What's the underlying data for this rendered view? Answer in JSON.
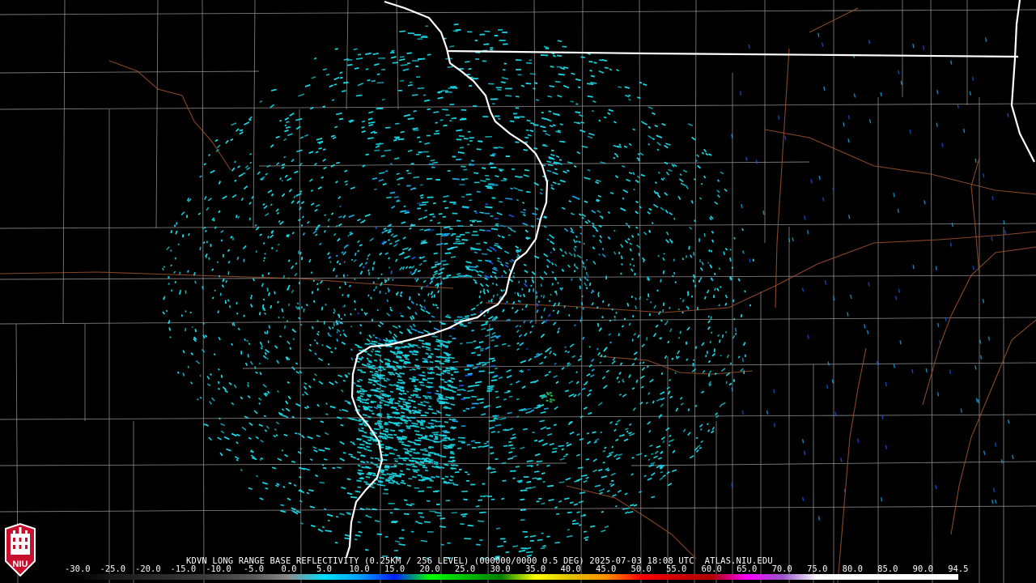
{
  "product": {
    "title": "KDVN LONG RANGE BASE REFLECTIVITY (0.25KM / 256 LEVEL) (000000/0000 0.5 DEG) 2025-07-03 18:08 UTC  ATLAS.NIU.EDU"
  },
  "legend": {
    "labels": [
      "-30.0",
      "-25.0",
      "-20.0",
      "-15.0",
      "-10.0",
      "-5.0",
      "0.0",
      "5.0",
      "10.0",
      "15.0",
      "20.0",
      "25.0",
      "30.0",
      "35.0",
      "40.0",
      "45.0",
      "50.0",
      "55.0",
      "60.0",
      "65.0",
      "70.0",
      "75.0",
      "80.0",
      "85.0",
      "90.0",
      "94.5"
    ],
    "stops": [
      "#000000",
      "#1a1a1a",
      "#262626",
      "#333333",
      "#404040",
      "#595959",
      "#8c8c8c",
      "#00e0ff",
      "#00a0ff",
      "#0020ff",
      "#00ff00",
      "#00c000",
      "#008000",
      "#ffff00",
      "#e0c000",
      "#ff9000",
      "#ff0000",
      "#d00000",
      "#b00000",
      "#ff00ff",
      "#9955c9",
      "#ffffff",
      "#ffffff",
      "#ffffff",
      "#ffffff",
      "#ffffff"
    ]
  },
  "logo": {
    "text": "NIU",
    "color": "#c8102e"
  },
  "map": {
    "echo_color_light": "#1ad9e6",
    "echo_color_mid": "#1aa7e6",
    "echo_color_deep": "#1a55e6",
    "state_border_color": "#ffffff",
    "county_color": "#9a9a9a",
    "highway_color": "#a0522d",
    "radar_site": "KDVN"
  }
}
